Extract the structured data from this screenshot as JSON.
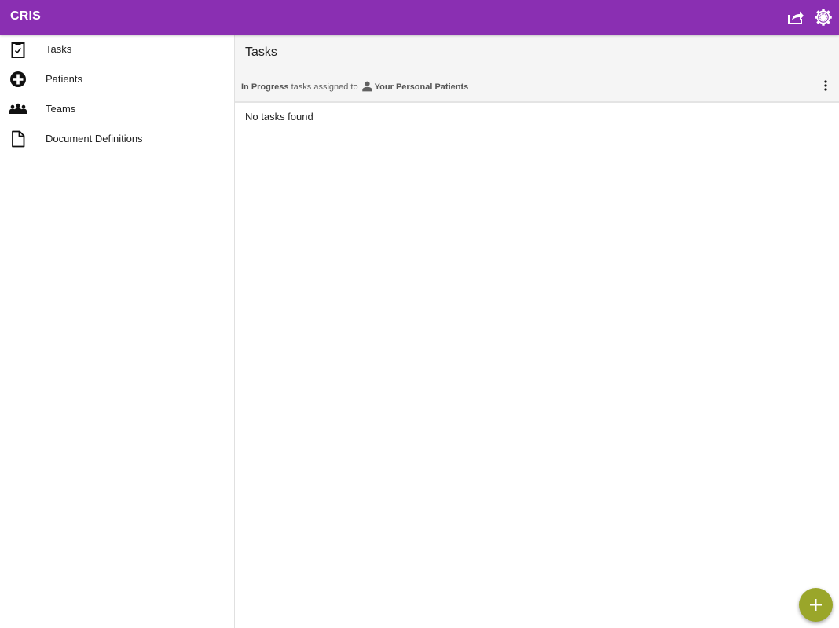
{
  "app": {
    "title": "CRIS"
  },
  "appbar": {
    "icons": [
      "share-icon",
      "settings-icon"
    ]
  },
  "sidebar": {
    "items": [
      {
        "label": "Tasks",
        "icon": "clipboard-check-icon"
      },
      {
        "label": "Patients",
        "icon": "plus-circle-icon"
      },
      {
        "label": "Teams",
        "icon": "group-icon"
      },
      {
        "label": "Document Definitions",
        "icon": "document-icon"
      }
    ]
  },
  "main": {
    "title": "Tasks",
    "filter": {
      "status": "In Progress",
      "text": "tasks assigned to",
      "assignee": "Your Personal Patients",
      "assignee_icon": "person-icon"
    },
    "empty_message": "No tasks found"
  },
  "fab": {
    "icon": "add-icon"
  },
  "colors": {
    "appbar": "#8a2fb2",
    "fab": "#9aa62a",
    "header_bg": "#f5f5f5"
  }
}
